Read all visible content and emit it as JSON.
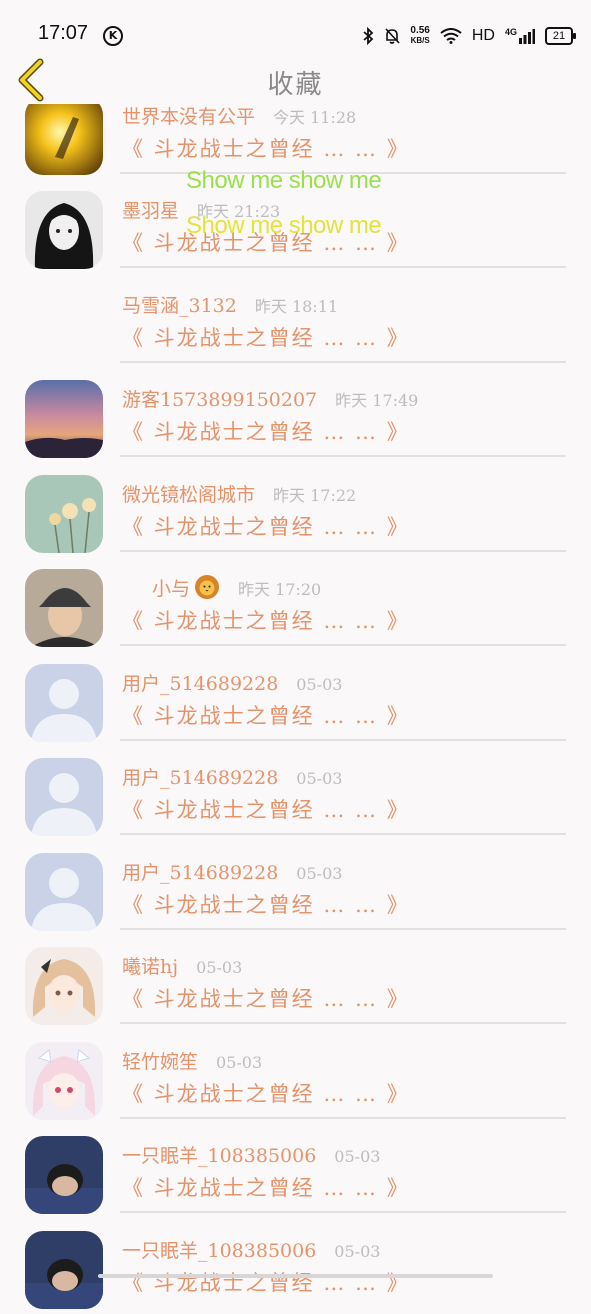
{
  "status_bar": {
    "time": "17:07",
    "k_badge": "K",
    "net_speed_value": "0.56",
    "net_speed_unit": "KB/S",
    "hd": "HD",
    "network": "4G",
    "battery": "21"
  },
  "header": {
    "title": "收藏"
  },
  "accent_color": "#e5936a",
  "rows": [
    {
      "name": "世界本没有公平",
      "time": "今天 11:28",
      "quote": "《 斗龙战士之曾经 … … 》"
    },
    {
      "name": "墨羽星",
      "time": "昨天 21:23",
      "quote": "《 斗龙战士之曾经 … … 》"
    },
    {
      "name": "马雪涵_3132",
      "time": "昨天 18:11",
      "quote": "《 斗龙战士之曾经 … … 》"
    },
    {
      "name": "游客1573899150207",
      "time": "昨天 17:49",
      "quote": "《 斗龙战士之曾经 … … 》"
    },
    {
      "name": "微光镜松阁城市",
      "time": "昨天 17:22",
      "quote": "《 斗龙战士之曾经 … … 》"
    },
    {
      "name": "小与",
      "time": "昨天 17:20",
      "quote": "《 斗龙战士之曾经 … … 》"
    },
    {
      "name": "用户_514689228",
      "time": "05-03",
      "quote": "《 斗龙战士之曾经 … … 》"
    },
    {
      "name": "用户_514689228",
      "time": "05-03",
      "quote": "《 斗龙战士之曾经 … … 》"
    },
    {
      "name": "用户_514689228",
      "time": "05-03",
      "quote": "《 斗龙战士之曾经 … … 》"
    },
    {
      "name": "曦诺hj",
      "time": "05-03",
      "quote": "《 斗龙战士之曾经 … … 》"
    },
    {
      "name": "轻竹婉笙",
      "time": "05-03",
      "quote": "《 斗龙战士之曾经 … … 》"
    },
    {
      "name": "一只眠羊_108385006",
      "time": "05-03",
      "quote": "《 斗龙战士之曾经 … … 》"
    },
    {
      "name": "一只眠羊_108385006",
      "time": "05-03",
      "quote": "《 斗龙战士之曾经 … … 》"
    }
  ],
  "danmaku": [
    "Show me show me",
    "Show me show me"
  ]
}
